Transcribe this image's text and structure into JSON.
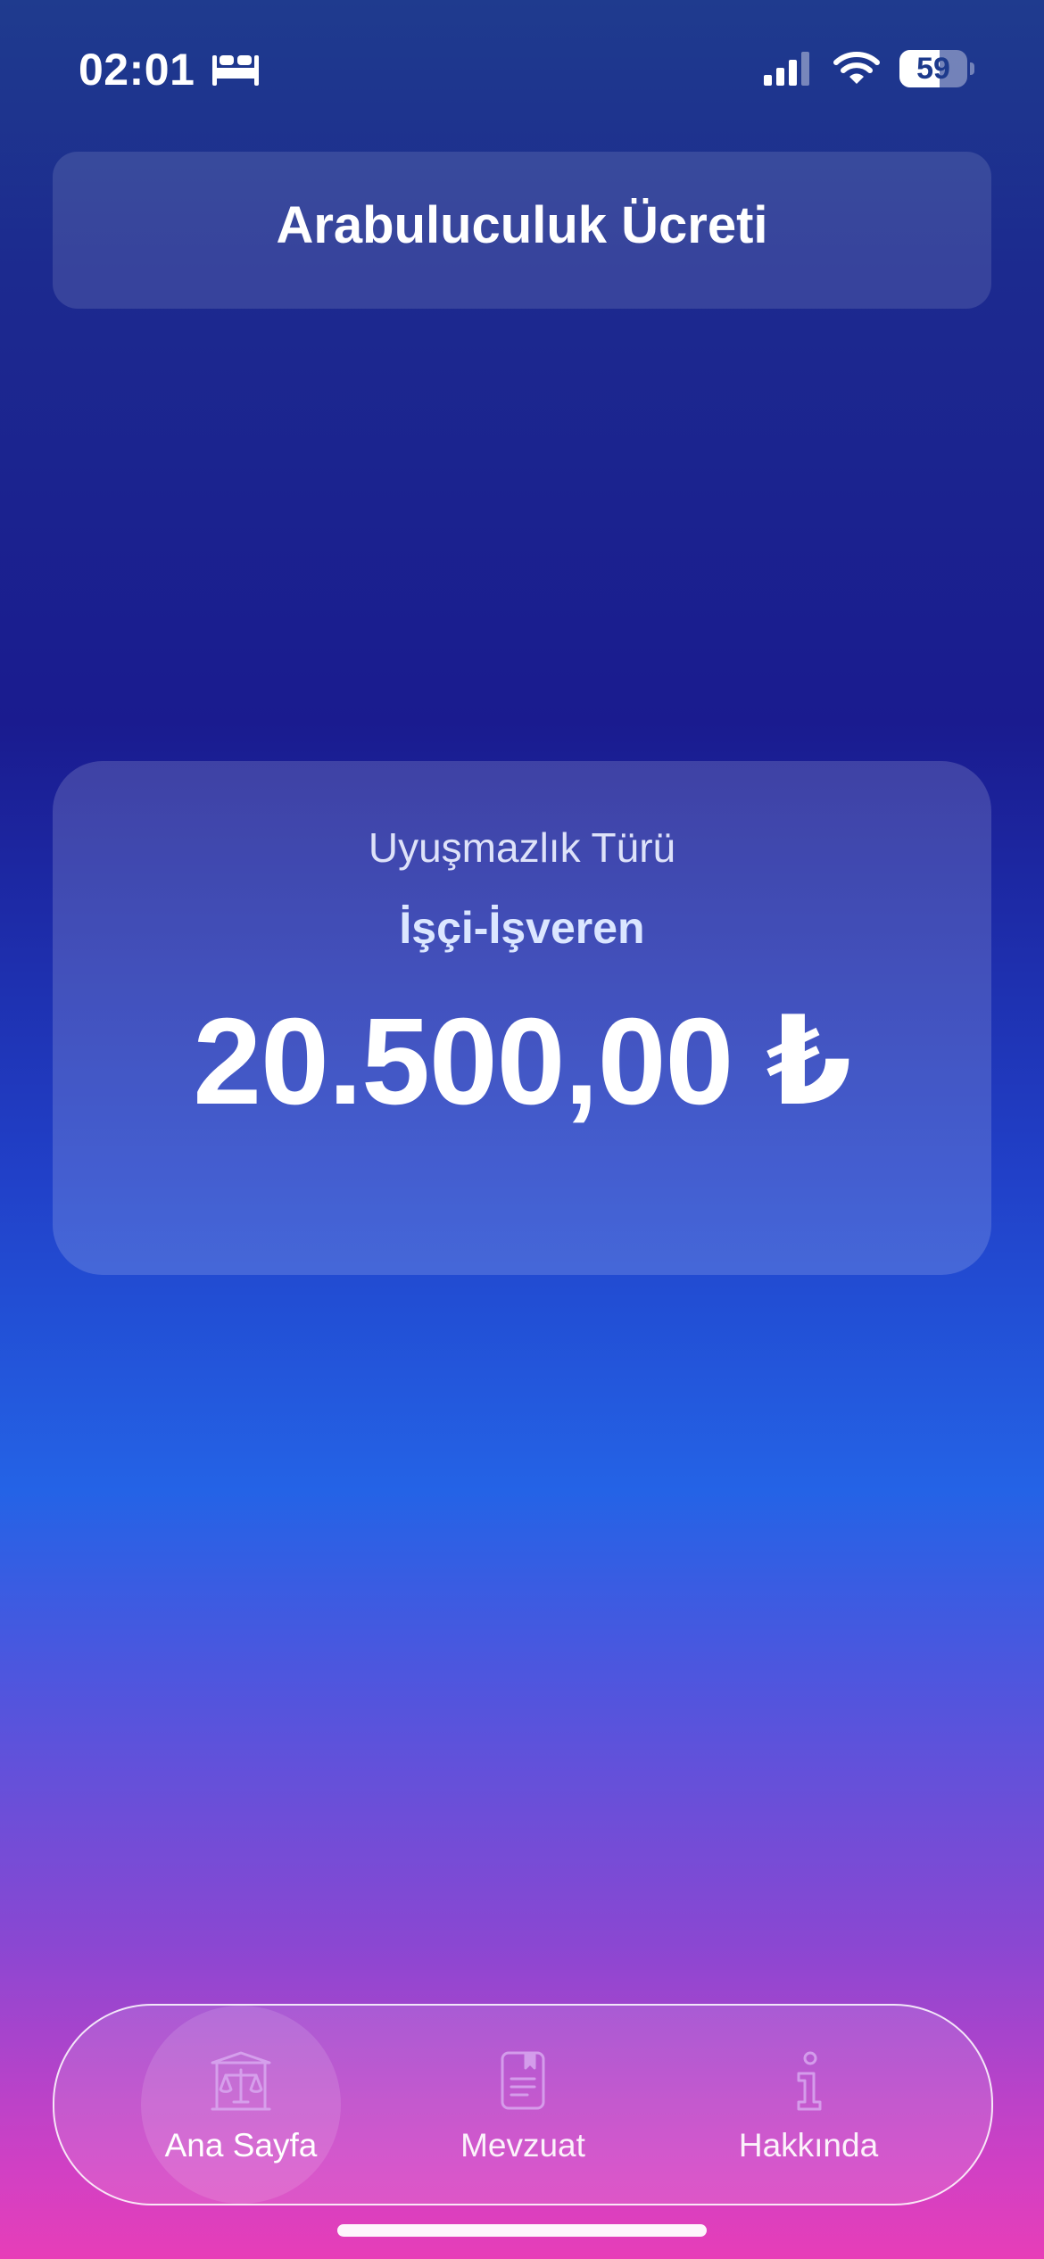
{
  "status_bar": {
    "time": "02:01",
    "battery_level": "59",
    "battery_fraction": 0.59,
    "icons": [
      "bed-icon",
      "signal-icon",
      "wifi-icon",
      "battery-icon"
    ]
  },
  "header": {
    "title": "Arabuluculuk Ücreti"
  },
  "result": {
    "dispute_label": "Uyuşmazlık Türü",
    "dispute_value": "İşçi-İşveren",
    "fee_amount": "20.500,00 ₺"
  },
  "tab_bar": {
    "items": [
      {
        "label": "Ana Sayfa",
        "icon": "scales-icon",
        "active": true
      },
      {
        "label": "Mevzuat",
        "icon": "document-icon",
        "active": false
      },
      {
        "label": "Hakkında",
        "icon": "info-icon",
        "active": false
      }
    ]
  },
  "colors": {
    "gradient_top": "#1f3b8e",
    "gradient_mid": "#2463e6",
    "gradient_bottom": "#e73eb8",
    "icon_tint": "#d9a8f0"
  }
}
